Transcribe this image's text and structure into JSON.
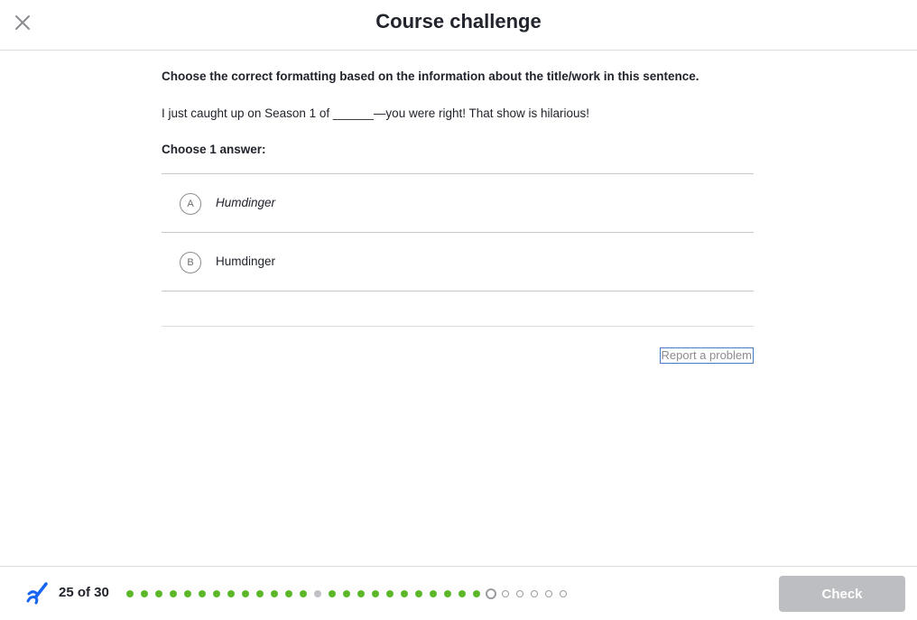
{
  "header": {
    "title": "Course challenge",
    "close_icon": "close-icon"
  },
  "question": {
    "instruction": "Choose the correct formatting based on the information about the title/work in this sentence.",
    "sentence": "I just caught up on Season 1 of ______—you were right! That show is hilarious!",
    "choose_label": "Choose 1 answer:",
    "choices": [
      {
        "letter": "A",
        "text": "Humdinger",
        "style": "italic"
      },
      {
        "letter": "B",
        "text": "Humdinger",
        "style": "normal"
      }
    ]
  },
  "report_link": "Report a problem",
  "footer": {
    "skill_icon": "skill-pencil-icon",
    "progress_text": "25 of 30",
    "progress": {
      "answered": 25,
      "total": 30
    },
    "dots": [
      "correct",
      "correct",
      "correct",
      "correct",
      "correct",
      "correct",
      "correct",
      "correct",
      "correct",
      "correct",
      "correct",
      "correct",
      "correct",
      "skipped",
      "correct",
      "correct",
      "correct",
      "correct",
      "correct",
      "correct",
      "correct",
      "correct",
      "correct",
      "correct",
      "correct",
      "current",
      "empty",
      "empty",
      "empty",
      "empty",
      "empty"
    ],
    "check_label": "Check"
  },
  "colors": {
    "correct": "#5cb82a",
    "skipped": "#bfc1c4",
    "check_disabled": "#bdbec1",
    "skill_icon": "#1865f2"
  }
}
